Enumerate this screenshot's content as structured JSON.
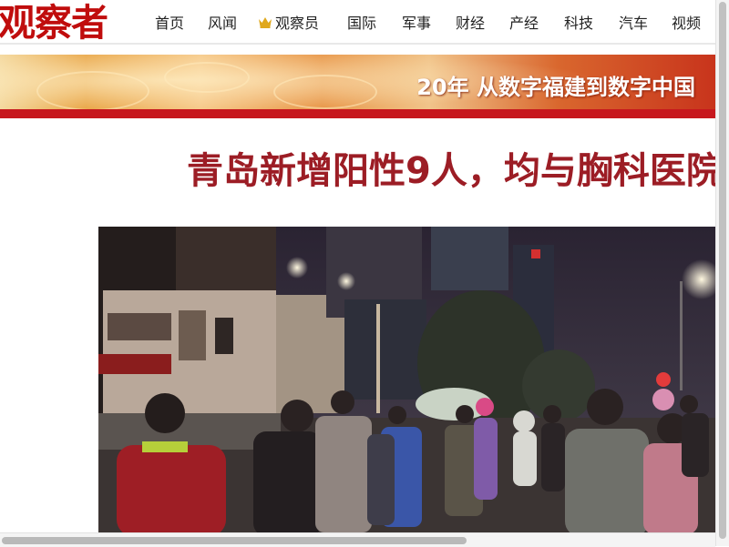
{
  "header": {
    "logo_text": "观察者",
    "nav": [
      {
        "label": "首页"
      },
      {
        "label": "风闻"
      },
      {
        "label": "观察员",
        "icon": "crown-icon"
      },
      {
        "label": "国际"
      },
      {
        "label": "军事"
      },
      {
        "label": "财经"
      },
      {
        "label": "产经"
      },
      {
        "label": "科技"
      },
      {
        "label": "汽车"
      },
      {
        "label": "视频"
      }
    ]
  },
  "banner": {
    "title": "20年 从数字福建到数字中国"
  },
  "article": {
    "headline": "青岛新增阳性9人，均与胸科医院"
  },
  "colors": {
    "brand_red": "#c00d0d",
    "headline_red": "#9c1d25",
    "crown_gold": "#e0a81c"
  }
}
